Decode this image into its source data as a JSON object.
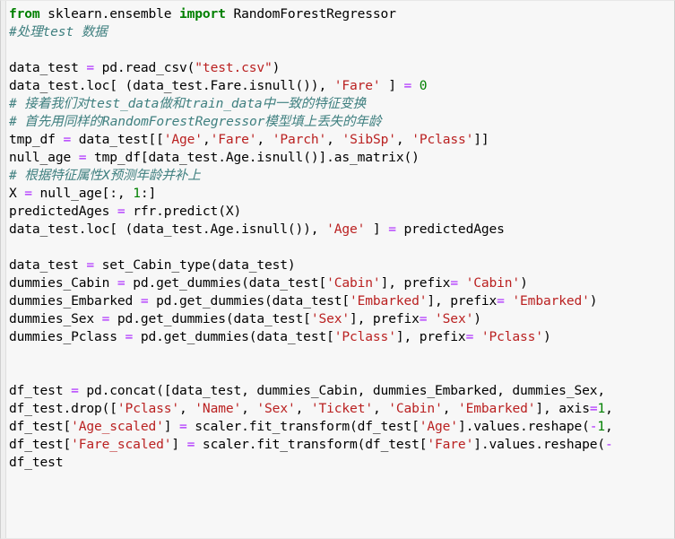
{
  "cell": {
    "language": "python",
    "background_color": "#f7f7f7",
    "gutter_color": "#efefef",
    "border_color": "#cfcfcf",
    "colors": {
      "keyword": "#008000",
      "comment": "#408080",
      "string": "#ba2121",
      "number": "#008000",
      "operator": "#aa22ff",
      "plain": "#000000"
    }
  },
  "lines": [
    {
      "index": 0,
      "text": "from sklearn.ensemble import RandomForestRegressor",
      "tokens": [
        {
          "t": "from",
          "c": "kw"
        },
        {
          "t": " sklearn.ensemble ",
          "c": "pl"
        },
        {
          "t": "import",
          "c": "kw"
        },
        {
          "t": " RandomForestRegressor",
          "c": "pl"
        }
      ]
    },
    {
      "index": 1,
      "text": "#处理test 数据",
      "tokens": [
        {
          "t": "#处理test 数据",
          "c": "cm"
        }
      ]
    },
    {
      "index": 2,
      "text": "",
      "tokens": []
    },
    {
      "index": 3,
      "text": "data_test = pd.read_csv(\"test.csv\")",
      "tokens": [
        {
          "t": "data_test ",
          "c": "pl"
        },
        {
          "t": "=",
          "c": "op"
        },
        {
          "t": " pd.read_csv(",
          "c": "pl"
        },
        {
          "t": "\"test.csv\"",
          "c": "str"
        },
        {
          "t": ")",
          "c": "pl"
        }
      ]
    },
    {
      "index": 4,
      "text": "data_test.loc[ (data_test.Fare.isnull()), 'Fare' ] = 0",
      "tokens": [
        {
          "t": "data_test.loc[ (data_test.Fare.isnull()), ",
          "c": "pl"
        },
        {
          "t": "'Fare'",
          "c": "str"
        },
        {
          "t": " ] ",
          "c": "pl"
        },
        {
          "t": "=",
          "c": "op"
        },
        {
          "t": " ",
          "c": "pl"
        },
        {
          "t": "0",
          "c": "num"
        }
      ]
    },
    {
      "index": 5,
      "text": "# 接着我们对test_data做和train_data中一致的特征变换",
      "tokens": [
        {
          "t": "# 接着我们对test_data做和train_data中一致的特征变换",
          "c": "cm"
        }
      ]
    },
    {
      "index": 6,
      "text": "# 首先用同样的RandomForestRegressor模型填上丢失的年龄",
      "tokens": [
        {
          "t": "# 首先用同样的RandomForestRegressor模型填上丢失的年龄",
          "c": "cm"
        }
      ]
    },
    {
      "index": 7,
      "text": "tmp_df = data_test[['Age','Fare', 'Parch', 'SibSp', 'Pclass']]",
      "tokens": [
        {
          "t": "tmp_df ",
          "c": "pl"
        },
        {
          "t": "=",
          "c": "op"
        },
        {
          "t": " data_test[[",
          "c": "pl"
        },
        {
          "t": "'Age'",
          "c": "str"
        },
        {
          "t": ",",
          "c": "pl"
        },
        {
          "t": "'Fare'",
          "c": "str"
        },
        {
          "t": ", ",
          "c": "pl"
        },
        {
          "t": "'Parch'",
          "c": "str"
        },
        {
          "t": ", ",
          "c": "pl"
        },
        {
          "t": "'SibSp'",
          "c": "str"
        },
        {
          "t": ", ",
          "c": "pl"
        },
        {
          "t": "'Pclass'",
          "c": "str"
        },
        {
          "t": "]]",
          "c": "pl"
        }
      ]
    },
    {
      "index": 8,
      "text": "null_age = tmp_df[data_test.Age.isnull()].as_matrix()",
      "tokens": [
        {
          "t": "null_age ",
          "c": "pl"
        },
        {
          "t": "=",
          "c": "op"
        },
        {
          "t": " tmp_df[data_test.Age.isnull()].as_matrix()",
          "c": "pl"
        }
      ]
    },
    {
      "index": 9,
      "text": "# 根据特征属性X预测年龄并补上",
      "tokens": [
        {
          "t": "# 根据特征属性X预测年龄并补上",
          "c": "cm"
        }
      ]
    },
    {
      "index": 10,
      "text": "X = null_age[:, 1:]",
      "tokens": [
        {
          "t": "X ",
          "c": "pl"
        },
        {
          "t": "=",
          "c": "op"
        },
        {
          "t": " null_age[:, ",
          "c": "pl"
        },
        {
          "t": "1",
          "c": "num"
        },
        {
          "t": ":]",
          "c": "pl"
        }
      ]
    },
    {
      "index": 11,
      "text": "predictedAges = rfr.predict(X)",
      "tokens": [
        {
          "t": "predictedAges ",
          "c": "pl"
        },
        {
          "t": "=",
          "c": "op"
        },
        {
          "t": " rfr.predict(X)",
          "c": "pl"
        }
      ]
    },
    {
      "index": 12,
      "text": "data_test.loc[ (data_test.Age.isnull()), 'Age' ] = predictedAges",
      "tokens": [
        {
          "t": "data_test.loc[ (data_test.Age.isnull()), ",
          "c": "pl"
        },
        {
          "t": "'Age'",
          "c": "str"
        },
        {
          "t": " ] ",
          "c": "pl"
        },
        {
          "t": "=",
          "c": "op"
        },
        {
          "t": " predictedAges",
          "c": "pl"
        }
      ]
    },
    {
      "index": 13,
      "text": "",
      "tokens": []
    },
    {
      "index": 14,
      "text": "data_test = set_Cabin_type(data_test)",
      "tokens": [
        {
          "t": "data_test ",
          "c": "pl"
        },
        {
          "t": "=",
          "c": "op"
        },
        {
          "t": " set_Cabin_type(data_test)",
          "c": "pl"
        }
      ]
    },
    {
      "index": 15,
      "text": "dummies_Cabin = pd.get_dummies(data_test['Cabin'], prefix= 'Cabin')",
      "tokens": [
        {
          "t": "dummies_Cabin ",
          "c": "pl"
        },
        {
          "t": "=",
          "c": "op"
        },
        {
          "t": " pd.get_dummies(data_test[",
          "c": "pl"
        },
        {
          "t": "'Cabin'",
          "c": "str"
        },
        {
          "t": "], prefix",
          "c": "pl"
        },
        {
          "t": "=",
          "c": "op"
        },
        {
          "t": " ",
          "c": "pl"
        },
        {
          "t": "'Cabin'",
          "c": "str"
        },
        {
          "t": ")",
          "c": "pl"
        }
      ]
    },
    {
      "index": 16,
      "text": "dummies_Embarked = pd.get_dummies(data_test['Embarked'], prefix= 'Embarked')",
      "tokens": [
        {
          "t": "dummies_Embarked ",
          "c": "pl"
        },
        {
          "t": "=",
          "c": "op"
        },
        {
          "t": " pd.get_dummies(data_test[",
          "c": "pl"
        },
        {
          "t": "'Embarked'",
          "c": "str"
        },
        {
          "t": "], prefix",
          "c": "pl"
        },
        {
          "t": "=",
          "c": "op"
        },
        {
          "t": " ",
          "c": "pl"
        },
        {
          "t": "'Embarked'",
          "c": "str"
        },
        {
          "t": ")",
          "c": "pl"
        }
      ]
    },
    {
      "index": 17,
      "text": "dummies_Sex = pd.get_dummies(data_test['Sex'], prefix= 'Sex')",
      "tokens": [
        {
          "t": "dummies_Sex ",
          "c": "pl"
        },
        {
          "t": "=",
          "c": "op"
        },
        {
          "t": " pd.get_dummies(data_test[",
          "c": "pl"
        },
        {
          "t": "'Sex'",
          "c": "str"
        },
        {
          "t": "], prefix",
          "c": "pl"
        },
        {
          "t": "=",
          "c": "op"
        },
        {
          "t": " ",
          "c": "pl"
        },
        {
          "t": "'Sex'",
          "c": "str"
        },
        {
          "t": ")",
          "c": "pl"
        }
      ]
    },
    {
      "index": 18,
      "text": "dummies_Pclass = pd.get_dummies(data_test['Pclass'], prefix= 'Pclass')",
      "tokens": [
        {
          "t": "dummies_Pclass ",
          "c": "pl"
        },
        {
          "t": "=",
          "c": "op"
        },
        {
          "t": " pd.get_dummies(data_test[",
          "c": "pl"
        },
        {
          "t": "'Pclass'",
          "c": "str"
        },
        {
          "t": "], prefix",
          "c": "pl"
        },
        {
          "t": "=",
          "c": "op"
        },
        {
          "t": " ",
          "c": "pl"
        },
        {
          "t": "'Pclass'",
          "c": "str"
        },
        {
          "t": ")",
          "c": "pl"
        }
      ]
    },
    {
      "index": 19,
      "text": "",
      "tokens": []
    },
    {
      "index": 20,
      "text": "",
      "tokens": []
    },
    {
      "index": 21,
      "text": "df_test = pd.concat([data_test, dummies_Cabin, dummies_Embarked, dummies_Sex,",
      "tokens": [
        {
          "t": "df_test ",
          "c": "pl"
        },
        {
          "t": "=",
          "c": "op"
        },
        {
          "t": " pd.concat([data_test, dummies_Cabin, dummies_Embarked, dummies_Sex,",
          "c": "pl"
        }
      ]
    },
    {
      "index": 22,
      "text": "df_test.drop(['Pclass', 'Name', 'Sex', 'Ticket', 'Cabin', 'Embarked'], axis=1,",
      "tokens": [
        {
          "t": "df_test.drop([",
          "c": "pl"
        },
        {
          "t": "'Pclass'",
          "c": "str"
        },
        {
          "t": ", ",
          "c": "pl"
        },
        {
          "t": "'Name'",
          "c": "str"
        },
        {
          "t": ", ",
          "c": "pl"
        },
        {
          "t": "'Sex'",
          "c": "str"
        },
        {
          "t": ", ",
          "c": "pl"
        },
        {
          "t": "'Ticket'",
          "c": "str"
        },
        {
          "t": ", ",
          "c": "pl"
        },
        {
          "t": "'Cabin'",
          "c": "str"
        },
        {
          "t": ", ",
          "c": "pl"
        },
        {
          "t": "'Embarked'",
          "c": "str"
        },
        {
          "t": "], axis",
          "c": "pl"
        },
        {
          "t": "=",
          "c": "op"
        },
        {
          "t": "1",
          "c": "num"
        },
        {
          "t": ",",
          "c": "pl"
        }
      ]
    },
    {
      "index": 23,
      "text": "df_test['Age_scaled'] = scaler.fit_transform(df_test['Age'].values.reshape(-1,",
      "tokens": [
        {
          "t": "df_test[",
          "c": "pl"
        },
        {
          "t": "'Age_scaled'",
          "c": "str"
        },
        {
          "t": "] ",
          "c": "pl"
        },
        {
          "t": "=",
          "c": "op"
        },
        {
          "t": " scaler.fit_transform(df_test[",
          "c": "pl"
        },
        {
          "t": "'Age'",
          "c": "str"
        },
        {
          "t": "].values.reshape(",
          "c": "pl"
        },
        {
          "t": "-",
          "c": "op"
        },
        {
          "t": "1",
          "c": "num"
        },
        {
          "t": ",",
          "c": "pl"
        }
      ]
    },
    {
      "index": 24,
      "text": "df_test['Fare_scaled'] = scaler.fit_transform(df_test['Fare'].values.reshape(-",
      "tokens": [
        {
          "t": "df_test[",
          "c": "pl"
        },
        {
          "t": "'Fare_scaled'",
          "c": "str"
        },
        {
          "t": "] ",
          "c": "pl"
        },
        {
          "t": "=",
          "c": "op"
        },
        {
          "t": " scaler.fit_transform(df_test[",
          "c": "pl"
        },
        {
          "t": "'Fare'",
          "c": "str"
        },
        {
          "t": "].values.reshape(",
          "c": "pl"
        },
        {
          "t": "-",
          "c": "op"
        }
      ]
    },
    {
      "index": 25,
      "text": "df_test",
      "tokens": [
        {
          "t": "df_test",
          "c": "pl"
        }
      ]
    }
  ]
}
